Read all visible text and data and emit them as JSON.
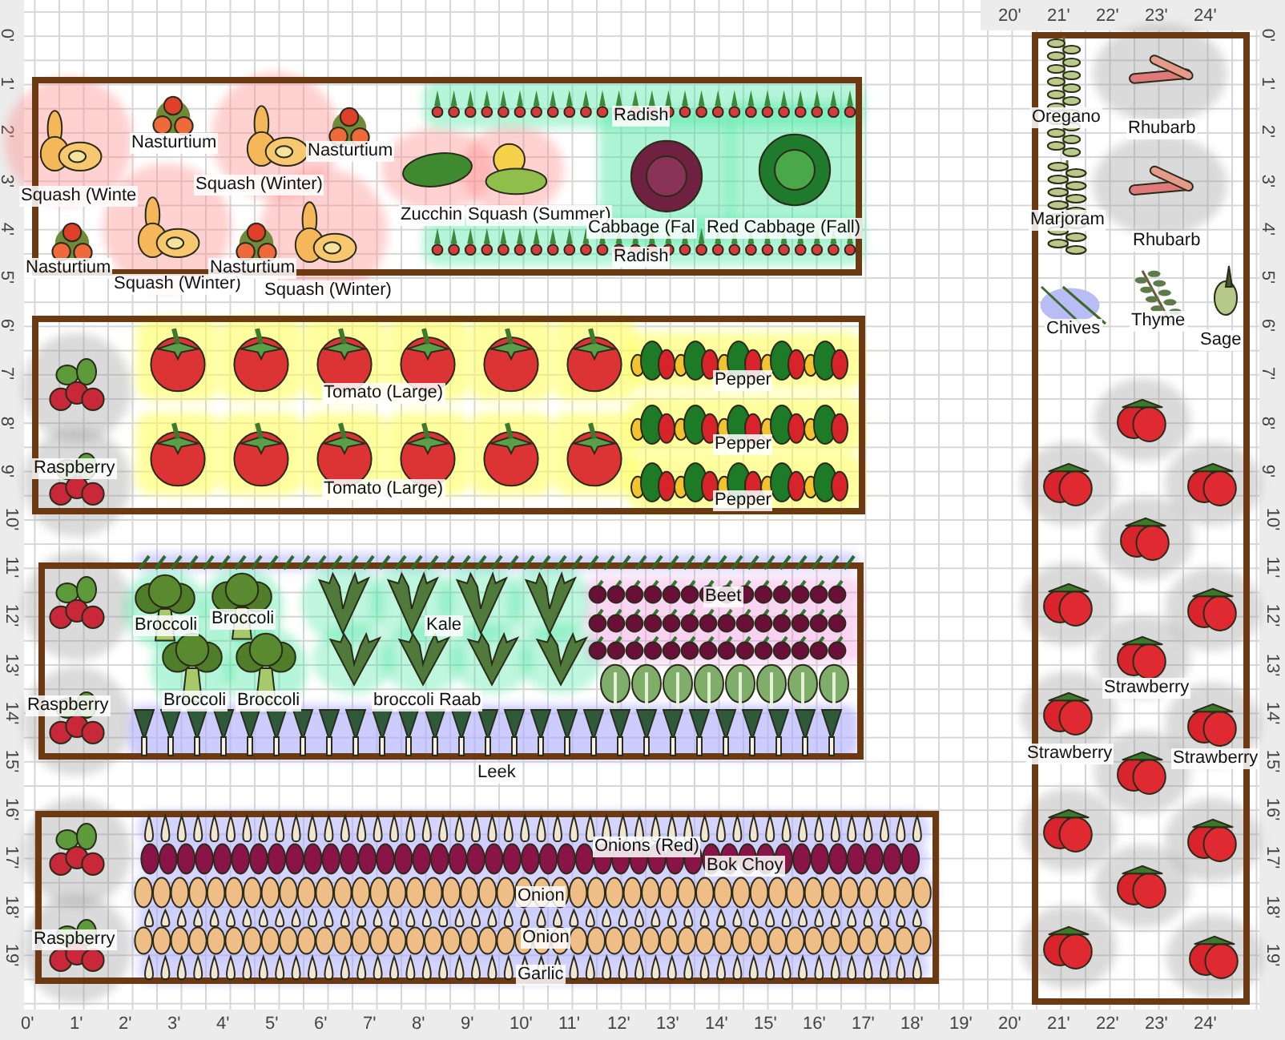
{
  "rulers": {
    "top": [
      "20'",
      "21'",
      "22'",
      "23'",
      "24'"
    ],
    "left": [
      "0'",
      "1'",
      "2'",
      "3'",
      "4'",
      "5'",
      "6'",
      "7'",
      "8'",
      "9'",
      "10'",
      "11'",
      "12'",
      "13'",
      "14'",
      "15'",
      "16'",
      "17'",
      "18'",
      "19'"
    ],
    "right": [
      "0'",
      "1'",
      "2'",
      "3'",
      "4'",
      "5'",
      "6'",
      "7'",
      "8'",
      "9'",
      "10'",
      "11'",
      "12'",
      "13'",
      "14'",
      "15'",
      "16'",
      "17'",
      "18'",
      "19'"
    ],
    "bottom": [
      "0'",
      "1'",
      "2'",
      "3'",
      "4'",
      "5'",
      "6'",
      "7'",
      "8'",
      "9'",
      "10'",
      "11'",
      "12'",
      "13'",
      "14'",
      "15'",
      "16'",
      "17'",
      "18'",
      "19'",
      "20'",
      "21'",
      "22'",
      "23'",
      "24'"
    ]
  },
  "beds": [
    {
      "plants": [
        {
          "kind": "squash"
        },
        {
          "kind": "squash"
        },
        {
          "kind": "squash"
        },
        {
          "kind": "squash"
        },
        {
          "kind": "nasturtium"
        },
        {
          "kind": "nasturtium"
        },
        {
          "kind": "nasturtium"
        },
        {
          "kind": "nasturtium"
        },
        {
          "kind": "zucchini"
        },
        {
          "kind": "summersquash"
        },
        {
          "kind": "radishes"
        },
        {
          "kind": "radishes"
        },
        {
          "kind": "redcabbage"
        },
        {
          "kind": "cabbage"
        }
      ],
      "labels": [
        "Squash (Winte",
        "Nasturtium",
        "Squash (Winter)",
        "Nasturtium",
        "Zucchin",
        "Squash (Summer)",
        "Radish",
        "Cabbage (Fal",
        "Red Cabbage (Fall)",
        "Radish",
        "Nasturtium",
        "Squash (Winter)",
        "Nasturtium",
        "Squash (Winter)"
      ]
    },
    {
      "plants": [
        {
          "kind": "raspberry"
        },
        {
          "kind": "raspberry"
        },
        {
          "kind": "tomato"
        },
        {
          "kind": "tomato"
        },
        {
          "kind": "tomato"
        },
        {
          "kind": "tomato"
        },
        {
          "kind": "tomato"
        },
        {
          "kind": "tomato"
        },
        {
          "kind": "tomato"
        },
        {
          "kind": "tomato"
        },
        {
          "kind": "tomato"
        },
        {
          "kind": "tomato"
        },
        {
          "kind": "tomato"
        },
        {
          "kind": "tomato"
        },
        {
          "kind": "peppers"
        },
        {
          "kind": "peppers"
        },
        {
          "kind": "peppers"
        }
      ],
      "labels": [
        "Raspberry",
        "Tomato (Large)",
        "Tomato (Large)",
        "Pepper",
        "Pepper",
        "Pepper"
      ]
    },
    {
      "plants": [
        {
          "kind": "raspberry"
        },
        {
          "kind": "raspberry"
        },
        {
          "kind": "scallions"
        },
        {
          "kind": "broccoli"
        },
        {
          "kind": "broccoli"
        },
        {
          "kind": "broccoli"
        },
        {
          "kind": "broccoli"
        },
        {
          "kind": "kale"
        },
        {
          "kind": "kale"
        },
        {
          "kind": "kale"
        },
        {
          "kind": "kale"
        },
        {
          "kind": "kale"
        },
        {
          "kind": "kale"
        },
        {
          "kind": "kale"
        },
        {
          "kind": "kale"
        },
        {
          "kind": "beets"
        },
        {
          "kind": "beets"
        },
        {
          "kind": "beets"
        },
        {
          "kind": "bokchoy"
        },
        {
          "kind": "leeks"
        }
      ],
      "labels": [
        "Raspberry",
        "Broccoli",
        "Broccoli",
        "Broccoli",
        "Broccoli",
        "Kale",
        "broccoli Raab",
        "Beet",
        "Leek"
      ]
    },
    {
      "plants": [
        {
          "kind": "raspberry"
        },
        {
          "kind": "raspberry"
        },
        {
          "kind": "garlic"
        },
        {
          "kind": "redonions"
        },
        {
          "kind": "onions"
        },
        {
          "kind": "garlic"
        },
        {
          "kind": "onions"
        },
        {
          "kind": "garlic"
        }
      ],
      "labels": [
        "Onions (Red)",
        "Bok Choy",
        "Onion",
        "Onion",
        "Garlic",
        "Raspberry"
      ]
    },
    {
      "plants": [
        {
          "kind": "herb"
        },
        {
          "kind": "herb"
        },
        {
          "kind": "rhubarb"
        },
        {
          "kind": "rhubarb"
        },
        {
          "kind": "chives"
        },
        {
          "kind": "thyme"
        },
        {
          "kind": "sage"
        },
        {
          "kind": "strawberry"
        },
        {
          "kind": "strawberry"
        },
        {
          "kind": "strawberry"
        },
        {
          "kind": "strawberry"
        },
        {
          "kind": "strawberry"
        },
        {
          "kind": "strawberry"
        },
        {
          "kind": "strawberry"
        },
        {
          "kind": "strawberry"
        },
        {
          "kind": "strawberry"
        },
        {
          "kind": "strawberry"
        },
        {
          "kind": "strawberry"
        },
        {
          "kind": "strawberry"
        },
        {
          "kind": "strawberry"
        },
        {
          "kind": "strawberry"
        },
        {
          "kind": "strawberry"
        }
      ],
      "labels": [
        "Oregano",
        "Rhubarb",
        "Marjoram",
        "Rhubarb",
        "Chives",
        "Thyme",
        "Sage",
        "Strawberry",
        "Strawberry",
        "Strawberry"
      ]
    }
  ]
}
